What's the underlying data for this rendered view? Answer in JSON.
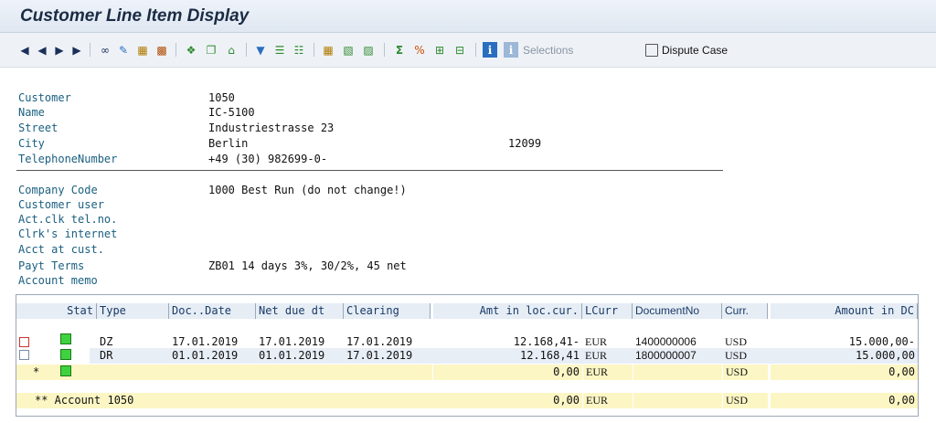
{
  "window": {
    "title": "Customer Line Item Display"
  },
  "toolbar": {
    "selections_label": "Selections",
    "dispute_label": "Dispute Case",
    "icons": [
      "first-page-icon",
      "previous-page-icon",
      "next-page-icon",
      "last-page-icon",
      "glasses-icon",
      "pencil-icon",
      "grid-icon",
      "chart-icon",
      "puzzle-icon",
      "copy-icon",
      "house-icon",
      "filter-icon",
      "sort-ascending-icon",
      "sort-descending-icon",
      "table-icon",
      "table-add-icon",
      "table-export-icon",
      "sum-icon",
      "subtotal-icon",
      "expand-icon",
      "collapse-icon",
      "info-icon",
      "selections-info-icon",
      "dispute-document-icon"
    ]
  },
  "customer": {
    "customer_label": "Customer",
    "customer_value": "1050",
    "name_label": "Name",
    "name_value": "IC-5100",
    "street_label": "Street",
    "street_value": "Industriestrasse 23",
    "city_label": "City",
    "city_value": "Berlin",
    "postal_code": "12099",
    "telephone_label": "TelephoneNumber",
    "telephone_value": "+49 (30) 982699-0-"
  },
  "company": {
    "company_code_label": "Company Code",
    "company_code_value": "1000 Best Run (do not change!)",
    "customer_user_label": "Customer user",
    "act_clk_label": "Act.clk tel.no.",
    "clerk_internet_label": "Clrk's internet",
    "acct_at_cust_label": "Acct at cust.",
    "payt_terms_label": "Payt Terms",
    "payt_terms_value": "ZB01 14 days 3%, 30/2%, 45 net",
    "account_memo_label": "Account memo"
  },
  "table": {
    "headers": {
      "stat": "Stat",
      "type": "Type",
      "doc_date": "Doc..Date",
      "net_due": "Net due dt",
      "clearing": "Clearing",
      "amt_loc": "Amt in loc.cur.",
      "lcurr": "LCurr",
      "docno": "DocumentNo",
      "curr": "Curr.",
      "amount_dc": "Amount in DC"
    },
    "rows": [
      {
        "type": "DZ",
        "doc_date": "17.01.2019",
        "net_due": "17.01.2019",
        "clearing": "17.01.2019",
        "amt_loc": "12.168,41-",
        "lcurr": "EUR",
        "docno": "1400000006",
        "curr": "USD",
        "amount_dc": "15.000,00-",
        "status_color": "#3fd23f"
      },
      {
        "type": "DR",
        "doc_date": "01.01.2019",
        "net_due": "01.01.2019",
        "clearing": "17.01.2019",
        "amt_loc": "12.168,41",
        "lcurr": "EUR",
        "docno": "1800000007",
        "curr": "USD",
        "amount_dc": "15.000,00",
        "status_color": "#3fd23f"
      }
    ],
    "subtotal": {
      "marker": "*",
      "amt_loc": "0,00",
      "lcurr": "EUR",
      "curr": "USD",
      "amount_dc": "0,00"
    },
    "total": {
      "label": "** Account 1050",
      "amt_loc": "0,00",
      "lcurr": "EUR",
      "curr": "USD",
      "amount_dc": "0,00"
    }
  }
}
